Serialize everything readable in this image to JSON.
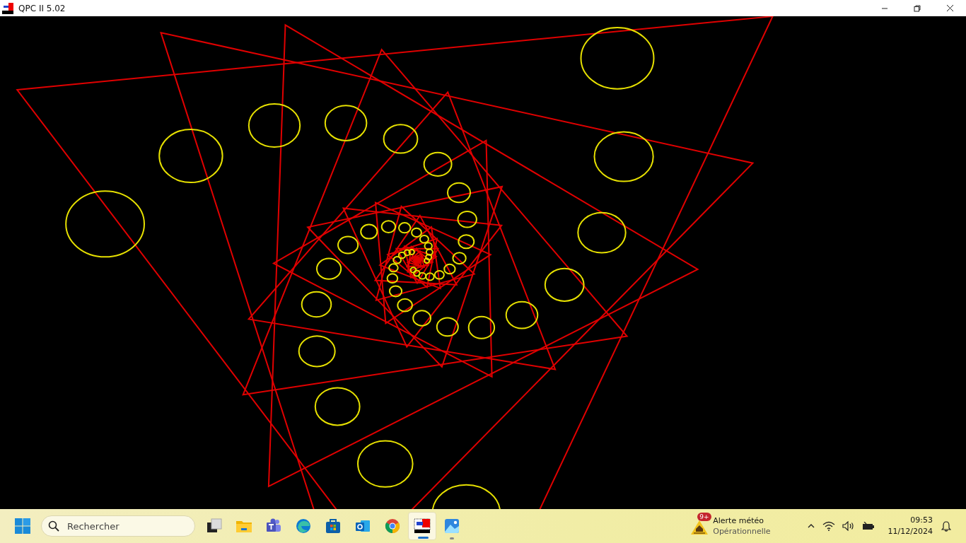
{
  "window": {
    "title": "QPC II 5.02",
    "controls": [
      {
        "kind": "minimize"
      },
      {
        "kind": "restore"
      },
      {
        "kind": "close"
      }
    ]
  },
  "taskbar": {
    "search": {
      "placeholder": "Rechercher"
    },
    "apps": [
      {
        "kind": "taskview",
        "selected": false,
        "running": false
      },
      {
        "kind": "folder",
        "selected": false,
        "running": false
      },
      {
        "kind": "teams",
        "selected": false,
        "running": false
      },
      {
        "kind": "edge",
        "selected": false,
        "running": false
      },
      {
        "kind": "store",
        "selected": false,
        "running": false
      },
      {
        "kind": "outlook",
        "selected": false,
        "running": false
      },
      {
        "kind": "chrome",
        "selected": false,
        "running": false
      },
      {
        "kind": "qpc",
        "selected": true,
        "running": true
      },
      {
        "kind": "photos",
        "selected": false,
        "running": true
      }
    ],
    "weather": {
      "badge": "9+",
      "title": "Alerte météo",
      "subtitle": "Opérationnelle"
    },
    "clock": {
      "time": "09:53",
      "date": "11/12/2024"
    }
  }
}
